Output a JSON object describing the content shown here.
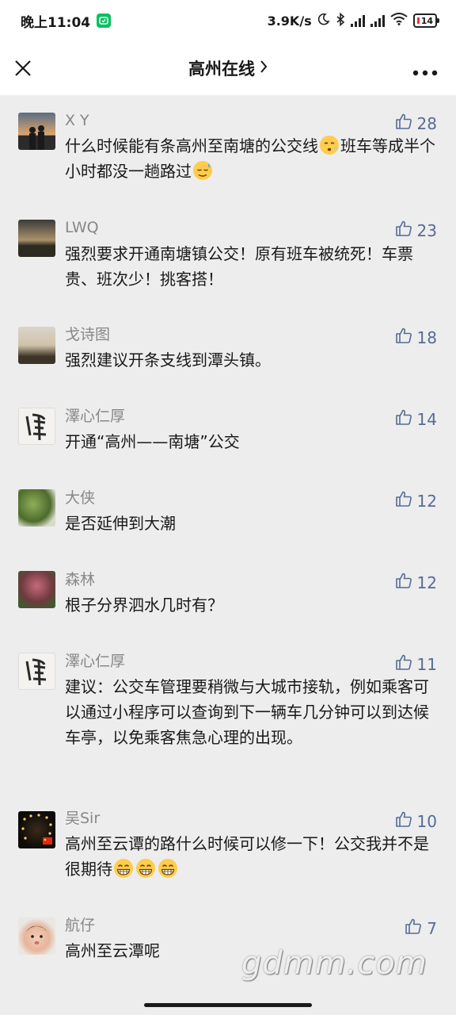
{
  "status_bar": {
    "time": "晚上11:04",
    "net_speed": "3.9K/s",
    "battery": "14",
    "colors": {
      "wechat": "#07c160",
      "battery_low": "#e53935"
    }
  },
  "nav": {
    "title": "高州在线",
    "title_chevron": ">",
    "close_icon": "close-icon",
    "more_icon": "more-icon"
  },
  "comments": [
    {
      "nickname": "X Y",
      "likes": "28",
      "avatar": "couple-sunset",
      "parts": [
        "什么时候能有条高州至南塘的公交线",
        {
          "emoji": "sigh"
        },
        "班车等成半个小时都没一趟路过",
        {
          "emoji": "sweat"
        }
      ]
    },
    {
      "nickname": "LWQ",
      "likes": "23",
      "avatar": "sunset-sky",
      "parts": [
        "强烈要求开通南塘镇公交！原有班车被统死！车票贵、班次少！挑客搭！"
      ]
    },
    {
      "nickname": "戈诗图",
      "likes": "18",
      "avatar": "river-reeds",
      "parts": [
        "强烈建议开条支线到潭头镇。"
      ]
    },
    {
      "nickname": "澤心仁厚",
      "likes": "14",
      "avatar": "calligraphy",
      "parts": [
        "开通“高州——南塘”公交"
      ]
    },
    {
      "nickname": "大侠",
      "likes": "12",
      "avatar": "green-leaves",
      "parts": [
        "是否延伸到大潮"
      ]
    },
    {
      "nickname": "森林",
      "likes": "12",
      "avatar": "pink-flowers",
      "parts": [
        "根子分界泗水几时有？"
      ]
    },
    {
      "nickname": "澤心仁厚",
      "likes": "11",
      "avatar": "calligraphy",
      "parts": [
        "建议：公交车管理要稍微与大城市接轨，例如乘客可以通过小程序可以查询到下一辆车几分钟可以到达候车亭，以免乘客焦急心理的出现。"
      ]
    },
    {
      "nickname": "吴Sir",
      "likes": "10",
      "avatar": "string-lights",
      "parts": [
        "高州至云谭的路什么时候可以修一下！公交我并不是很期待",
        {
          "emoji": "grin"
        },
        {
          "emoji": "grin"
        },
        {
          "emoji": "grin"
        }
      ]
    },
    {
      "nickname": "航⁠仔",
      "likes": "7",
      "avatar": "baby-photo",
      "parts": [
        "高州至云潭呢"
      ]
    }
  ],
  "watermark": "gdmm.com",
  "colors": {
    "link_blue": "#576b95",
    "nickname_gray": "#888888",
    "background": "#ededed"
  }
}
